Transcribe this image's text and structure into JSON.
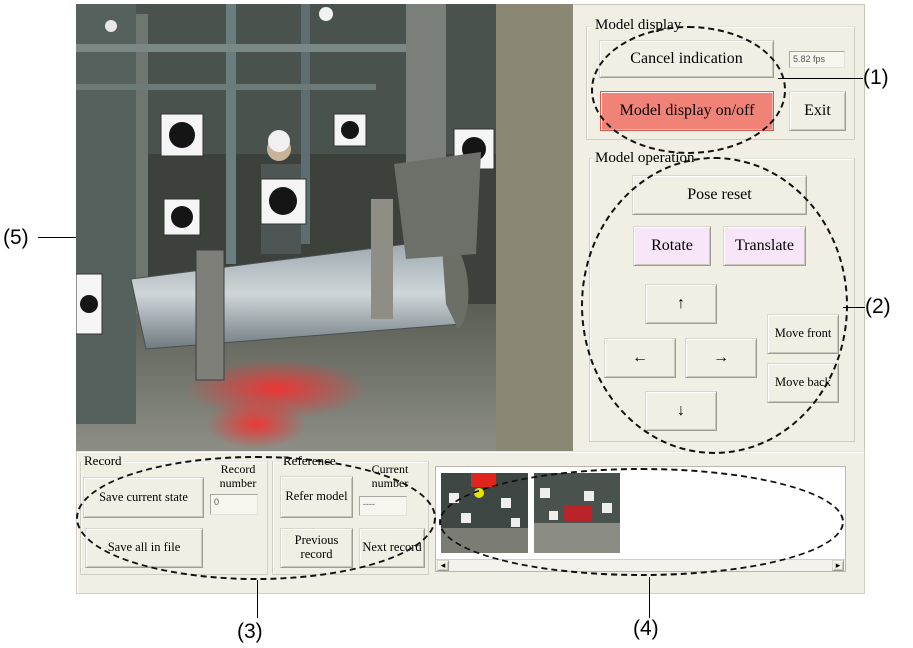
{
  "model_display": {
    "title": "Model display",
    "cancel_label": "Cancel indication",
    "fps_value": "5.82 fps",
    "display_toggle_label": "Model display on/off",
    "exit_label": "Exit"
  },
  "model_operation": {
    "title": "Model operation",
    "pose_reset_label": "Pose reset",
    "rotate_label": "Rotate",
    "translate_label": "Translate",
    "up_label": "↑",
    "left_label": "←",
    "right_label": "→",
    "down_label": "↓",
    "move_front_label": "Move front",
    "move_back_label": "Move back"
  },
  "record": {
    "title": "Record",
    "save_current_label": "Save current state",
    "record_number_label": "Record number",
    "record_number_value": "0",
    "save_all_label": "Save all in file"
  },
  "reference": {
    "title": "Reference",
    "refer_model_label": "Refer model",
    "current_number_label": "Current number",
    "current_number_value": "----",
    "previous_record_label": "Previous record",
    "next_record_label": "Next record"
  },
  "thumbnails": {
    "scroll_left": "◂",
    "scroll_right": "▸"
  },
  "callouts": {
    "c1": "(1)",
    "c2": "(2)",
    "c3": "(3)",
    "c4": "(4)",
    "c5": "(5)"
  },
  "colors": {
    "panel_bg": "#f1efe4",
    "toggle_active": "#f08278",
    "mode_button": "#f6e6f7"
  }
}
